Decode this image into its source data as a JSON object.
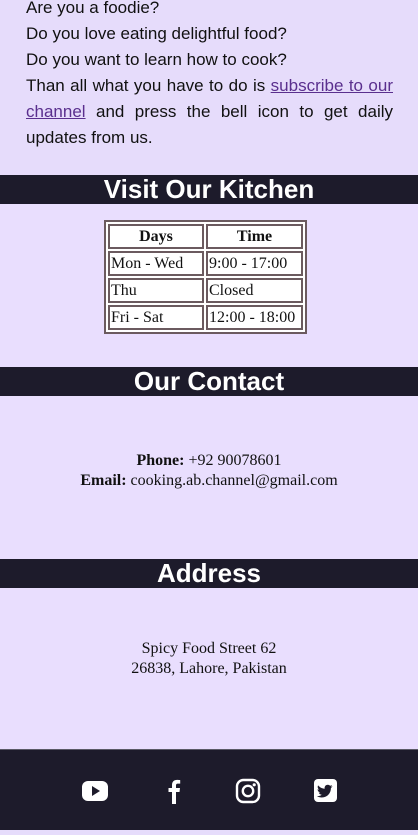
{
  "intro": {
    "line1": "Are you a foodie?",
    "line2": "Do you love eating delightful food?",
    "line3": "Do you want to learn how to cook?",
    "para_before": "Than all what you have to do is ",
    "link_text": "subscribe to our channel",
    "para_after": " and press the bell icon to get daily updates from us."
  },
  "kitchen": {
    "heading": "Visit Our Kitchen",
    "headers": [
      "Days",
      "Time"
    ],
    "rows": [
      [
        "Mon - Wed",
        "9:00 - 17:00"
      ],
      [
        "Thu",
        "Closed"
      ],
      [
        "Fri - Sat",
        "12:00 - 18:00"
      ]
    ]
  },
  "contact": {
    "heading": "Our Contact",
    "phone_label": "Phone:",
    "phone_value": " +92 90078601",
    "email_label": "Email:",
    "email_value": " cooking.ab.channel@gmail.com"
  },
  "address": {
    "heading": "Address",
    "line1": "Spicy Food Street 62",
    "line2": "26838, Lahore, Pakistan"
  },
  "footer": {
    "icons": [
      "youtube-icon",
      "facebook-icon",
      "instagram-icon",
      "twitter-icon"
    ]
  },
  "colors": {
    "page_bg": "#e6dcfb",
    "band_bg": "#1d1b2b",
    "link": "#5a2f8e"
  }
}
